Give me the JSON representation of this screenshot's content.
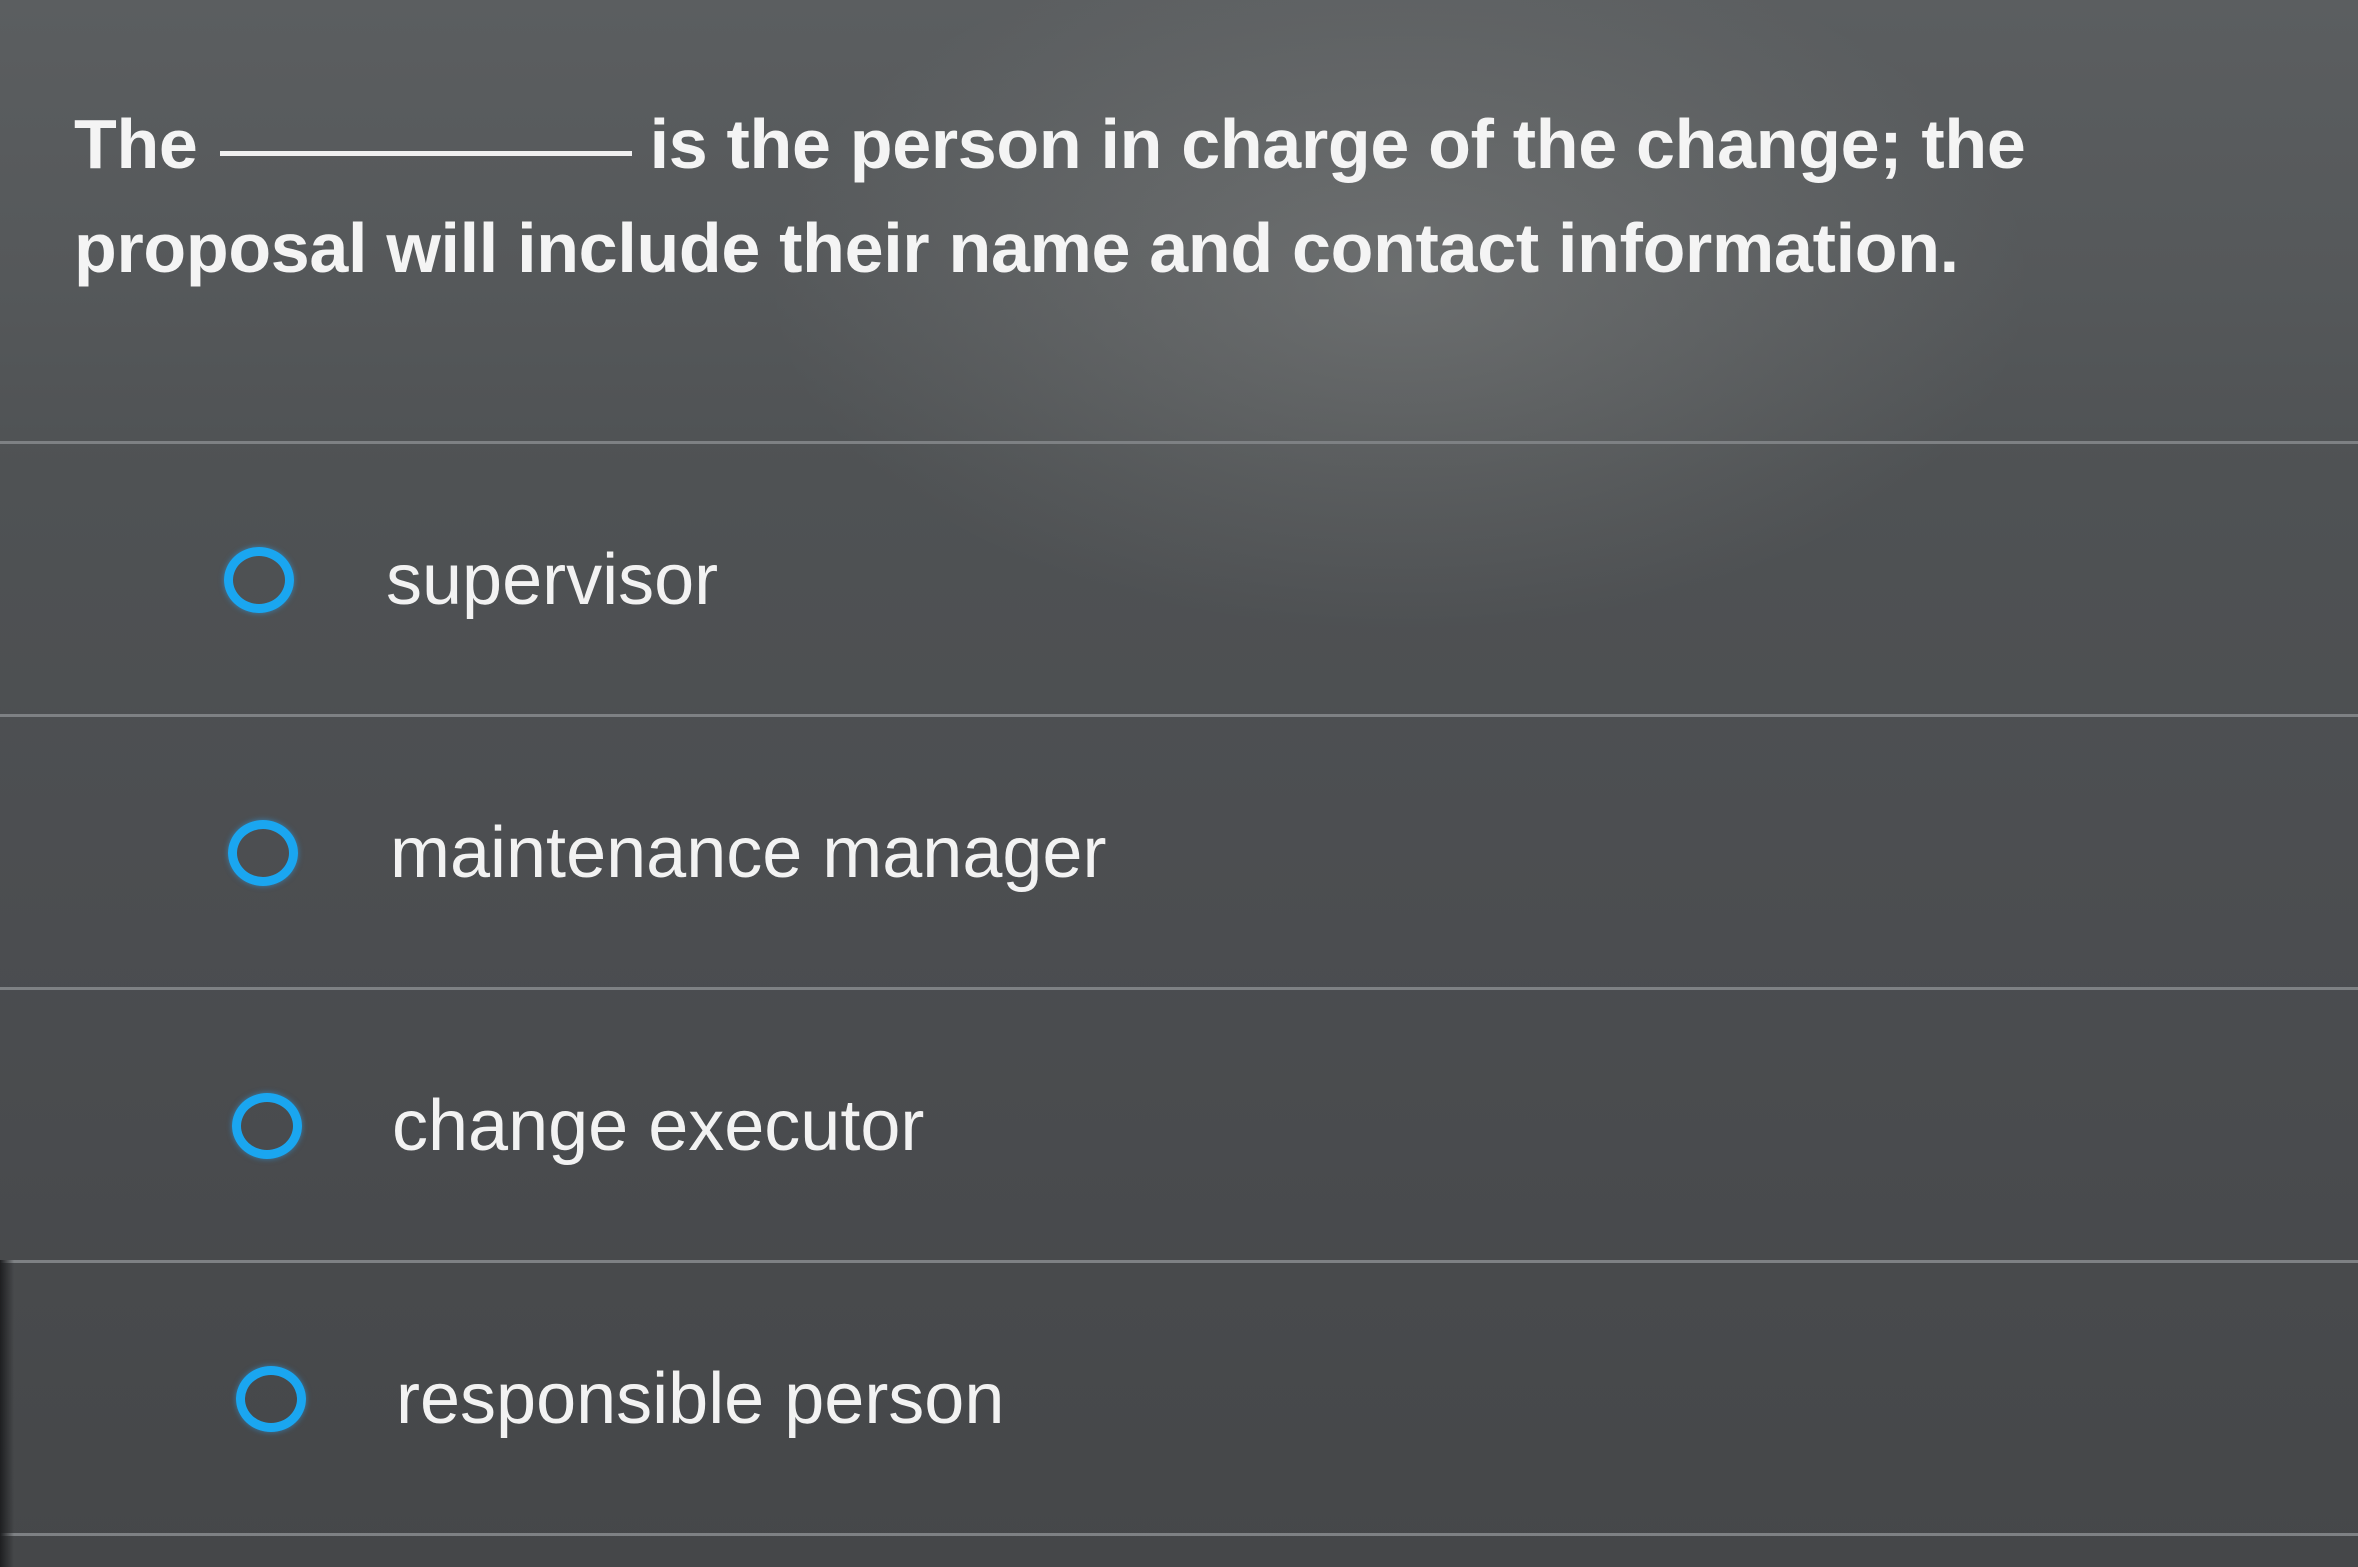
{
  "question": {
    "prefix": "The",
    "suffix_line1": "is the person in charge of the change; the",
    "line2": "proposal will include their name and contact information."
  },
  "options": [
    {
      "label": "supervisor",
      "selected": false
    },
    {
      "label": "maintenance manager",
      "selected": false
    },
    {
      "label": "change executor",
      "selected": false
    },
    {
      "label": "responsible person",
      "selected": false
    }
  ],
  "colors": {
    "background": "#4b4d50",
    "radio_accent": "#1aa6f0",
    "divider": "#7e8184",
    "text": "#f2f2f2"
  },
  "icons": {
    "radio": "radio-button-unselected-icon"
  }
}
